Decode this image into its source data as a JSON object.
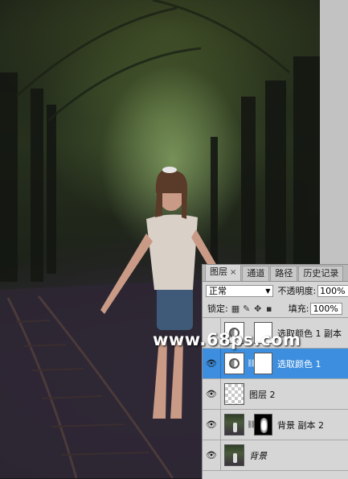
{
  "panel": {
    "tabs": [
      {
        "label": "图层",
        "close": "×",
        "active": true
      },
      {
        "label": "通道"
      },
      {
        "label": "路径"
      },
      {
        "label": "历史记录"
      }
    ],
    "blend_mode": "正常",
    "opacity_label": "不透明度:",
    "opacity_value": "100%",
    "lock_label": "锁定:",
    "fill_label": "填充:",
    "fill_value": "100%",
    "lock_icons": [
      "transparency-lock-icon",
      "brush-lock-icon",
      "move-lock-icon",
      "padlock-icon"
    ],
    "layers": [
      {
        "name": "选取颜色 1 副本",
        "visible": false,
        "thumb": "adjustment",
        "mask": "white"
      },
      {
        "name": "选取颜色 1",
        "visible": true,
        "selected": true,
        "thumb": "adjustment",
        "mask": "white"
      },
      {
        "name": "图层 2",
        "visible": true,
        "thumb": "transparent"
      },
      {
        "name": "背景 副本 2",
        "visible": true,
        "thumb": "photo",
        "mask": "black"
      },
      {
        "name": "背景",
        "visible": true,
        "thumb": "photo",
        "italic": true
      }
    ]
  },
  "watermark": "www.68ps.com",
  "colors": {
    "selected_layer": "#3d8ede",
    "panel_bg": "#d6d6d6",
    "gray_side": "#c2c2c2"
  }
}
